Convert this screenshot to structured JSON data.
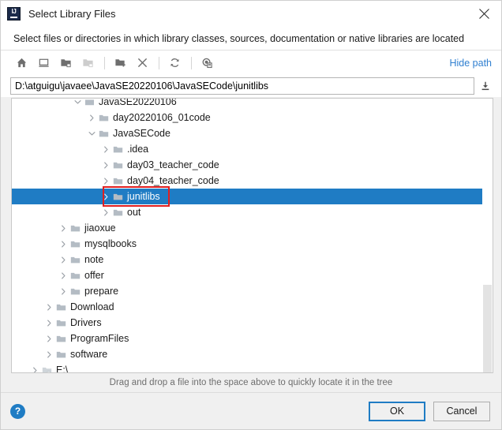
{
  "window": {
    "title": "Select Library Files",
    "app_icon": "intellij-idea-icon",
    "close_icon": "close-icon",
    "subtitle": "Select files or directories in which library classes, sources, documentation or native libraries are located"
  },
  "toolbar": {
    "buttons": [
      {
        "name": "home-icon",
        "tooltip": "Home"
      },
      {
        "name": "desktop-icon",
        "tooltip": "Desktop"
      },
      {
        "name": "folder-up-icon",
        "tooltip": "Up"
      },
      {
        "name": "folder-up-disabled-icon",
        "tooltip": "Up"
      },
      {
        "name": "new-folder-icon",
        "tooltip": "New Folder"
      },
      {
        "name": "delete-icon",
        "tooltip": "Delete"
      },
      {
        "name": "refresh-icon",
        "tooltip": "Refresh"
      },
      {
        "name": "show-hidden-files-icon",
        "tooltip": "Show Hidden Files"
      }
    ],
    "hide_path_label": "Hide path"
  },
  "path_field": {
    "value": "D:\\atguigu\\javaee\\JavaSE20220106\\JavaSECode\\junitlibs",
    "placeholder": "",
    "download_icon": "download-icon"
  },
  "tree": {
    "rows": [
      {
        "label": "JavaSE20220106",
        "indent": 4,
        "state": "expanded",
        "selected": false,
        "folder": "folder-open-icon"
      },
      {
        "label": "day20220106_01code",
        "indent": 5,
        "state": "collapsed",
        "selected": false,
        "folder": "folder-icon"
      },
      {
        "label": "JavaSECode",
        "indent": 5,
        "state": "expanded",
        "selected": false,
        "folder": "folder-icon"
      },
      {
        "label": ".idea",
        "indent": 6,
        "state": "collapsed",
        "selected": false,
        "folder": "folder-icon"
      },
      {
        "label": "day03_teacher_code",
        "indent": 6,
        "state": "collapsed",
        "selected": false,
        "folder": "folder-icon"
      },
      {
        "label": "day04_teacher_code",
        "indent": 6,
        "state": "collapsed",
        "selected": false,
        "folder": "folder-icon"
      },
      {
        "label": "junitlibs",
        "indent": 6,
        "state": "collapsed",
        "selected": true,
        "folder": "folder-icon"
      },
      {
        "label": "out",
        "indent": 6,
        "state": "collapsed",
        "selected": false,
        "folder": "folder-icon"
      },
      {
        "label": "jiaoxue",
        "indent": 3,
        "state": "collapsed",
        "selected": false,
        "folder": "folder-icon"
      },
      {
        "label": "mysqlbooks",
        "indent": 3,
        "state": "collapsed",
        "selected": false,
        "folder": "folder-icon"
      },
      {
        "label": "note",
        "indent": 3,
        "state": "collapsed",
        "selected": false,
        "folder": "folder-icon"
      },
      {
        "label": "offer",
        "indent": 3,
        "state": "collapsed",
        "selected": false,
        "folder": "folder-icon"
      },
      {
        "label": "prepare",
        "indent": 3,
        "state": "collapsed",
        "selected": false,
        "folder": "folder-icon"
      },
      {
        "label": "Download",
        "indent": 2,
        "state": "collapsed",
        "selected": false,
        "folder": "folder-icon"
      },
      {
        "label": "Drivers",
        "indent": 2,
        "state": "collapsed",
        "selected": false,
        "folder": "folder-icon"
      },
      {
        "label": "ProgramFiles",
        "indent": 2,
        "state": "collapsed",
        "selected": false,
        "folder": "folder-icon"
      },
      {
        "label": "software",
        "indent": 2,
        "state": "collapsed",
        "selected": false,
        "folder": "folder-icon"
      },
      {
        "label": "E:\\",
        "indent": 1,
        "state": "collapsed",
        "selected": false,
        "folder": "drive-icon"
      }
    ],
    "scrollbar": {
      "thumb_top_pct": 68,
      "thumb_height_pct": 32
    }
  },
  "annotation": {
    "type": "red-rectangle",
    "color": "#e02020",
    "target": "junitlibs"
  },
  "hint": "Drag and drop a file into the space above to quickly locate it in the tree",
  "footer": {
    "help_icon": "help-icon",
    "help_label": "?",
    "ok_label": "OK",
    "cancel_label": "Cancel"
  },
  "colors": {
    "accent": "#1f7cc4",
    "link": "#2f7fd0",
    "selection": "#1f7cc4",
    "annotation": "#e02020",
    "folder": "#b4bcc4"
  }
}
